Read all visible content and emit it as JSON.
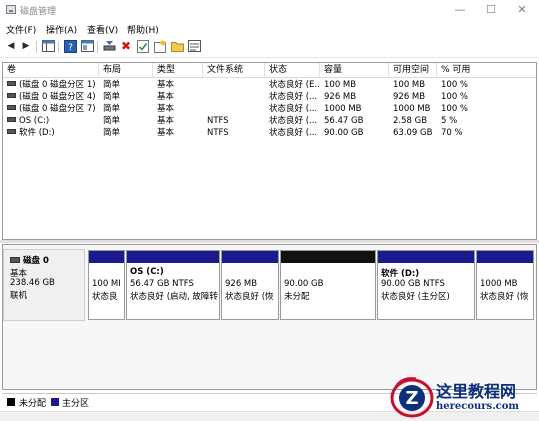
{
  "window": {
    "title": "磁盘管理",
    "minimize_glyph": "—",
    "maximize_glyph": "☐",
    "close_glyph": "✕"
  },
  "menu": [
    "文件(F)",
    "操作(A)",
    "查看(V)",
    "帮助(H)"
  ],
  "toolbar": {
    "back_glyph": "◀",
    "forward_glyph": "▶",
    "icons": [
      "console-tree-icon",
      "help-icon",
      "properties-icon",
      "connect-disk-icon",
      "delete-icon",
      "check-icon",
      "new-volume-icon",
      "folder-icon",
      "view-icon"
    ]
  },
  "volumes": {
    "headers": [
      "卷",
      "布局",
      "类型",
      "文件系统",
      "状态",
      "容量",
      "可用空间",
      "% 可用"
    ],
    "rows": [
      [
        "(磁盘 0 磁盘分区 1)",
        "简单",
        "基本",
        "",
        "状态良好 (E...",
        "100 MB",
        "100 MB",
        "100 %"
      ],
      [
        "(磁盘 0 磁盘分区 4)",
        "简单",
        "基本",
        "",
        "状态良好 (...",
        "926 MB",
        "926 MB",
        "100 %"
      ],
      [
        "(磁盘 0 磁盘分区 7)",
        "简单",
        "基本",
        "",
        "状态良好 (...",
        "1000 MB",
        "1000 MB",
        "100 %"
      ],
      [
        "OS (C:)",
        "简单",
        "基本",
        "NTFS",
        "状态良好 (...",
        "56.47 GB",
        "2.58 GB",
        "5 %"
      ],
      [
        "软件 (D:)",
        "简单",
        "基本",
        "NTFS",
        "状态良好 (...",
        "90.00 GB",
        "63.09 GB",
        "70 %"
      ]
    ]
  },
  "disk": {
    "name": "磁盘 0",
    "type": "基本",
    "size": "238.46 GB",
    "status": "联机"
  },
  "partitions": [
    {
      "name": "",
      "size": "100 MI",
      "status": "状态良",
      "color": "#1b1b8f"
    },
    {
      "name": "OS  (C:)",
      "size": "56.47 GB NTFS",
      "status": "状态良好 (启动, 故障转",
      "color": "#1b1b8f"
    },
    {
      "name": "",
      "size": "926 MB",
      "status": "状态良好 (恢",
      "color": "#1b1b8f"
    },
    {
      "name": "",
      "size": "90.00 GB",
      "status": "未分配",
      "color": "#111111"
    },
    {
      "name": "软件  (D:)",
      "size": "90.00 GB NTFS",
      "status": "状态良好 (主分区)",
      "color": "#1b1b8f"
    },
    {
      "name": "",
      "size": "1000 MB",
      "status": "状态良好 (恢",
      "color": "#1b1b8f"
    }
  ],
  "legend": [
    {
      "label": "未分配",
      "color": "#000000"
    },
    {
      "label": "主分区",
      "color": "#1b1b8f"
    }
  ],
  "watermark": {
    "letter": "Z",
    "title": "这里教程网",
    "domain": "herecours.com",
    "color": "#0b2f7a",
    "accent": "#c8102e"
  }
}
